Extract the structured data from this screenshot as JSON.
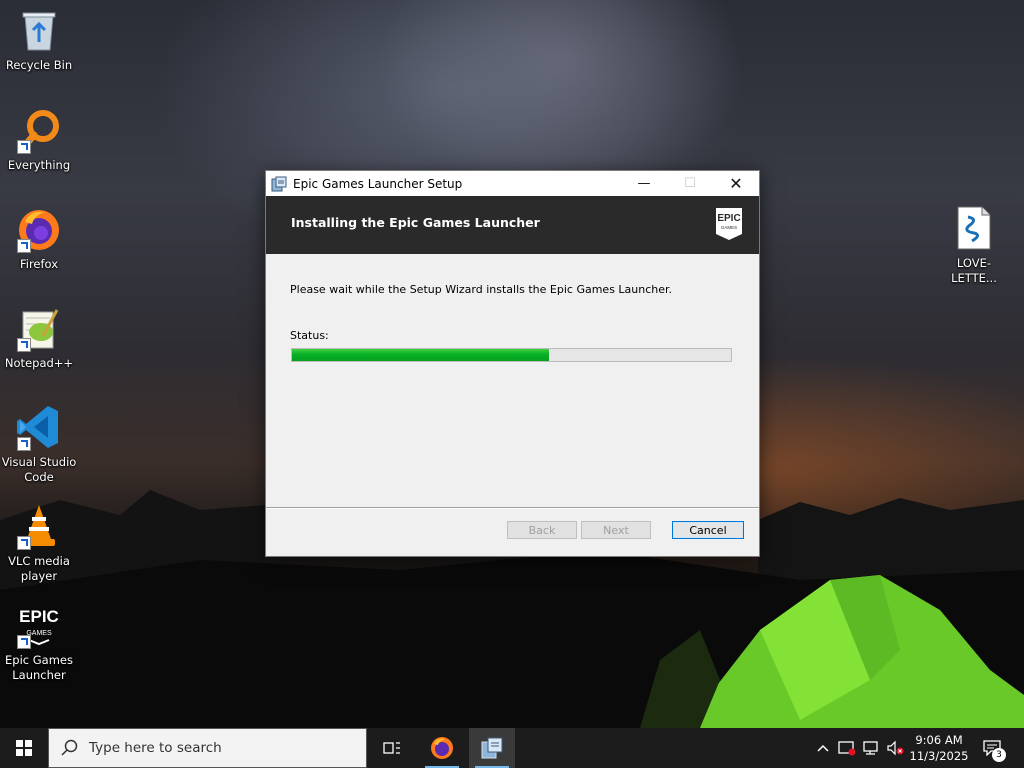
{
  "desktop": {
    "icons": [
      {
        "label": "Recycle Bin",
        "icon": "recycle-bin-icon"
      },
      {
        "label": "Everything",
        "icon": "everything-search-icon"
      },
      {
        "label": "Firefox",
        "icon": "firefox-icon"
      },
      {
        "label": "Notepad++",
        "icon": "notepad-plus-plus-icon"
      },
      {
        "label": "Visual Studio Code",
        "label_line1": "Visual Studio",
        "label_line2": "Code",
        "icon": "vscode-icon"
      },
      {
        "label": "VLC media player",
        "label_line1": "VLC media",
        "label_line2": "player",
        "icon": "vlc-icon"
      },
      {
        "label": "Epic Games Launcher",
        "label_line1": "Epic Games",
        "label_line2": "Launcher",
        "icon": "epic-games-icon"
      },
      {
        "label": "LOVE-LETTE...",
        "icon": "script-file-icon"
      }
    ]
  },
  "installer": {
    "window_title": "Epic Games Launcher Setup",
    "heading": "Installing the Epic Games Launcher",
    "message": "Please wait while the Setup Wizard installs the Epic Games Launcher.",
    "status_label": "Status:",
    "progress_fraction": 0.585,
    "buttons": {
      "back": "Back",
      "next": "Next",
      "cancel": "Cancel"
    },
    "logo_text_top": "EPIC",
    "logo_text_bottom": "GAMES"
  },
  "taskbar": {
    "search_placeholder": "Type here to search",
    "pinned": [
      "task-view-icon",
      "firefox-icon",
      "installer-icon"
    ],
    "tray_icons": [
      "chevron-up-icon",
      "security-warning-icon",
      "network-disconnected-icon",
      "volume-muted-icon"
    ],
    "time": "9:06 AM",
    "date": "11/3/2025",
    "notification_count": "3"
  },
  "colors": {
    "progress_green": "#06b025",
    "banner_bg": "#2a2a2a",
    "taskbar_bg": "#1c1c1c",
    "focus_blue": "#0078d7"
  }
}
